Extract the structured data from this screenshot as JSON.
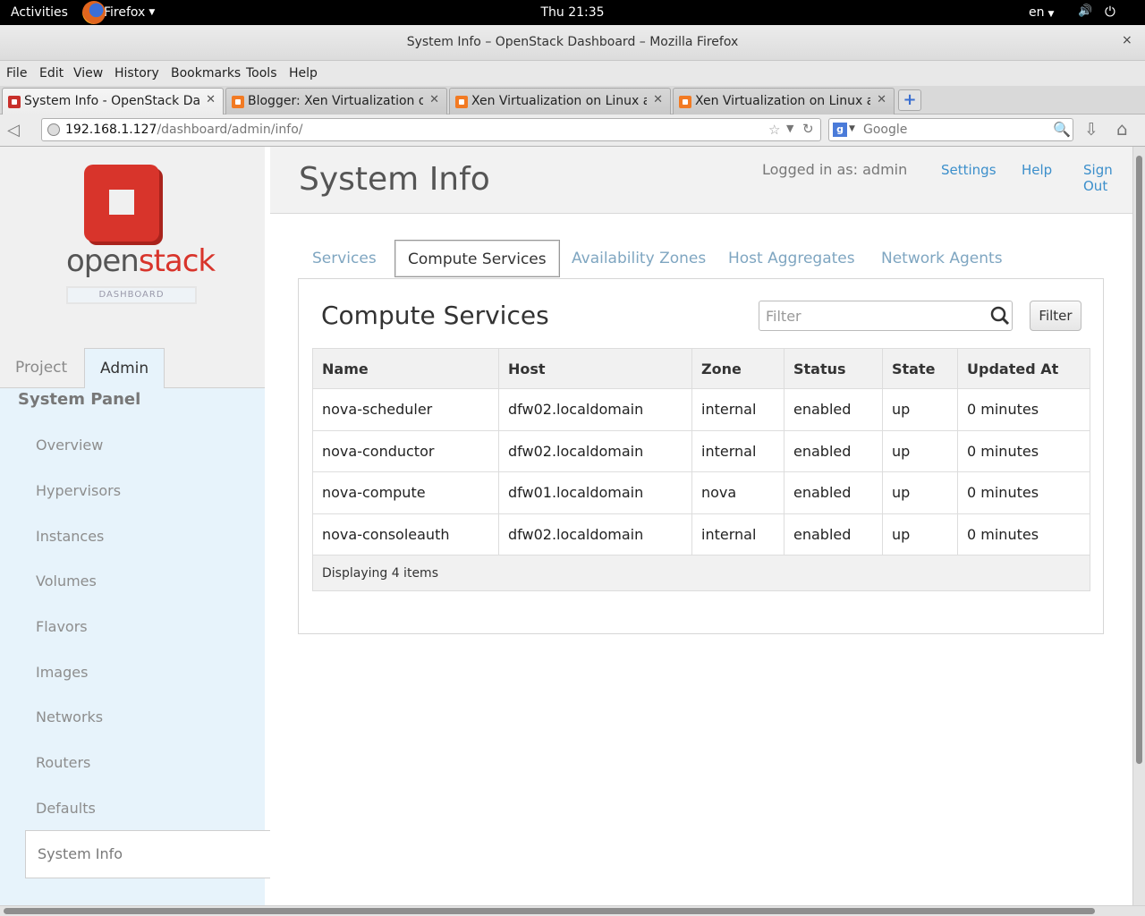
{
  "topbar": {
    "activities": "Activities",
    "app": "Firefox",
    "clock": "Thu 21:35",
    "lang": "en"
  },
  "window": {
    "title": "System Info – OpenStack Dashboard – Mozilla Firefox",
    "close": "×"
  },
  "menu": [
    "File",
    "Edit",
    "View",
    "History",
    "Bookmarks",
    "Tools",
    "Help"
  ],
  "tabs": [
    {
      "label": "System Info - OpenStack Da...",
      "favicon": "openstack"
    },
    {
      "label": "Blogger: Xen Virtualization o...",
      "favicon": "blogger"
    },
    {
      "label": "Xen Virtualization on Linux a...",
      "favicon": "blogger"
    },
    {
      "label": "Xen Virtualization on Linux a...",
      "favicon": "blogger"
    }
  ],
  "nav": {
    "url_host": "192.168.1.127",
    "url_path": "/dashboard/admin/info/",
    "search_placeholder": "Google"
  },
  "sidebar": {
    "logo_open": "open",
    "logo_stack": "stack",
    "logo_dashboard": "DASHBOARD",
    "tab_project": "Project",
    "tab_admin": "Admin",
    "panel_title": "System Panel",
    "items": [
      "Overview",
      "Hypervisors",
      "Instances",
      "Volumes",
      "Flavors",
      "Images",
      "Networks",
      "Routers",
      "Defaults"
    ],
    "selected": "System Info"
  },
  "header": {
    "title": "System Info",
    "logged_in": "Logged in as: admin",
    "settings": "Settings",
    "help": "Help",
    "sign_out": "Sign Out"
  },
  "content_tabs": [
    "Services",
    "Compute Services",
    "Availability Zones",
    "Host Aggregates",
    "Network Agents"
  ],
  "panel": {
    "title": "Compute Services",
    "filter_placeholder": "Filter",
    "filter_button": "Filter",
    "columns": [
      "Name",
      "Host",
      "Zone",
      "Status",
      "State",
      "Updated At"
    ],
    "rows": [
      [
        "nova-scheduler",
        "dfw02.localdomain",
        "internal",
        "enabled",
        "up",
        "0 minutes"
      ],
      [
        "nova-conductor",
        "dfw02.localdomain",
        "internal",
        "enabled",
        "up",
        "0 minutes"
      ],
      [
        "nova-compute",
        "dfw01.localdomain",
        "nova",
        "enabled",
        "up",
        "0 minutes"
      ],
      [
        "nova-consoleauth",
        "dfw02.localdomain",
        "internal",
        "enabled",
        "up",
        "0 minutes"
      ]
    ],
    "footer": "Displaying 4 items"
  }
}
